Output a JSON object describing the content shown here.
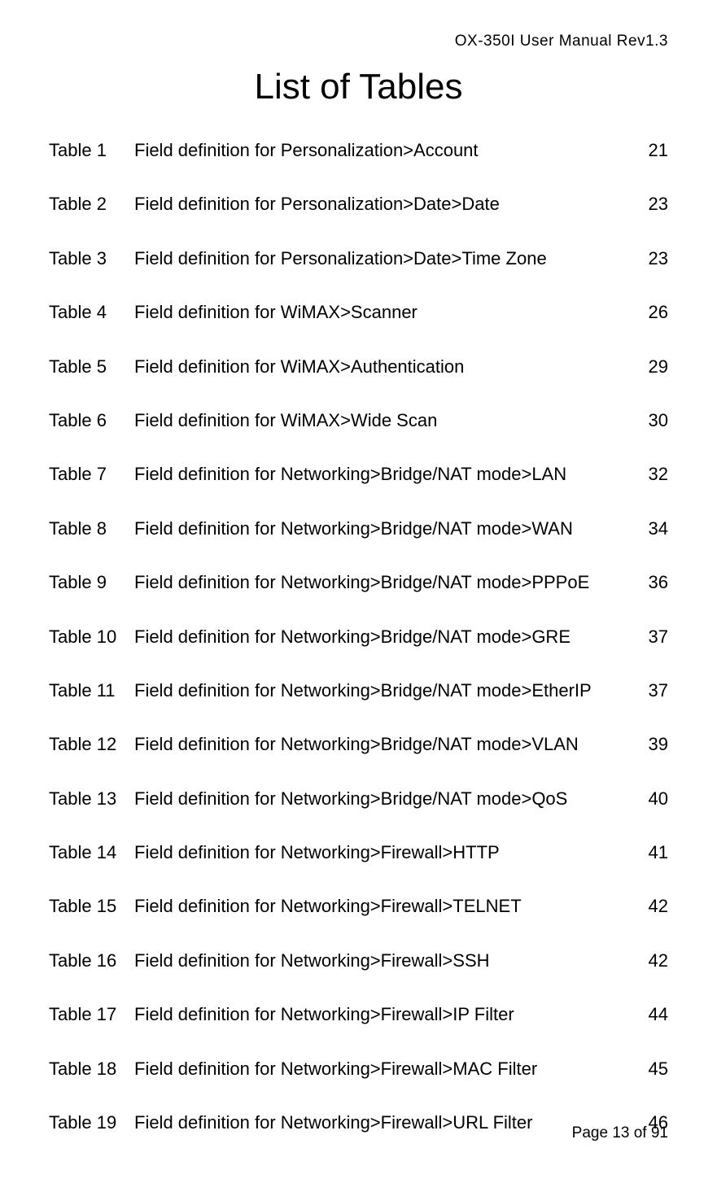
{
  "header": "OX-350I User Manual Rev1.3",
  "title": "List of Tables",
  "entries": [
    {
      "label": "Table 1",
      "desc": "Field definition for Personalization>Account",
      "page": "21"
    },
    {
      "label": "Table 2",
      "desc": "Field definition for Personalization>Date>Date",
      "page": "23"
    },
    {
      "label": "Table 3",
      "desc": "Field definition for Personalization>Date>Time Zone",
      "page": "23"
    },
    {
      "label": "Table 4",
      "desc": "Field definition for WiMAX>Scanner",
      "page": "26"
    },
    {
      "label": "Table 5",
      "desc": "Field definition for WiMAX>Authentication",
      "page": "29"
    },
    {
      "label": "Table 6",
      "desc": "Field definition for WiMAX>Wide Scan",
      "page": "30"
    },
    {
      "label": "Table 7",
      "desc": "Field definition for Networking>Bridge/NAT mode>LAN",
      "page": "32"
    },
    {
      "label": "Table 8",
      "desc": "Field definition for Networking>Bridge/NAT mode>WAN",
      "page": "34"
    },
    {
      "label": "Table 9",
      "desc": "Field definition for Networking>Bridge/NAT mode>PPPoE",
      "page": "36"
    },
    {
      "label": "Table 10",
      "desc": "Field definition for Networking>Bridge/NAT mode>GRE",
      "page": "37"
    },
    {
      "label": "Table 11",
      "desc": "Field definition for Networking>Bridge/NAT mode>EtherIP",
      "page": "37"
    },
    {
      "label": "Table 12",
      "desc": "Field definition for Networking>Bridge/NAT mode>VLAN",
      "page": "39"
    },
    {
      "label": "Table 13",
      "desc": "Field definition for Networking>Bridge/NAT mode>QoS",
      "page": "40"
    },
    {
      "label": "Table 14",
      "desc": "Field definition for Networking>Firewall>HTTP",
      "page": "41"
    },
    {
      "label": "Table 15",
      "desc": "Field definition for Networking>Firewall>TELNET",
      "page": "42"
    },
    {
      "label": "Table 16",
      "desc": "Field definition for Networking>Firewall>SSH",
      "page": "42"
    },
    {
      "label": "Table 17",
      "desc": "Field definition for Networking>Firewall>IP Filter",
      "page": "44"
    },
    {
      "label": "Table 18",
      "desc": "Field definition for Networking>Firewall>MAC Filter",
      "page": "45"
    },
    {
      "label": "Table 19",
      "desc": "Field definition for Networking>Firewall>URL Filter",
      "page": "46"
    }
  ],
  "footer": "Page 13 of 91"
}
